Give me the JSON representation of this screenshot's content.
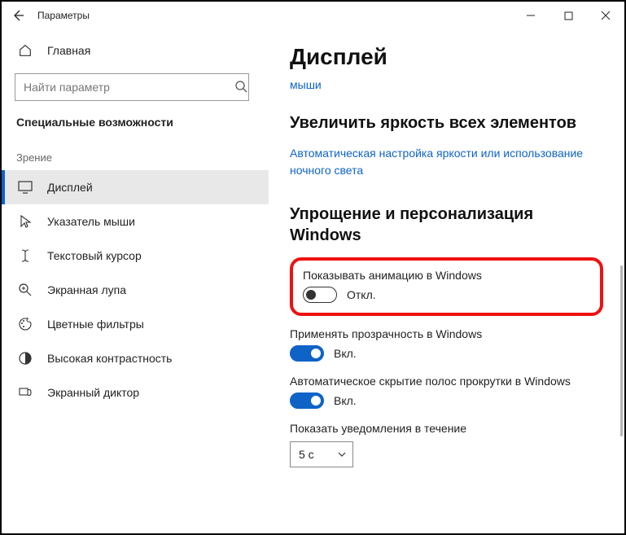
{
  "titlebar": {
    "title": "Параметры"
  },
  "sidebar": {
    "home": "Главная",
    "search_placeholder": "Найти параметр",
    "category": "Специальные возможности",
    "group_vision": "Зрение",
    "items": [
      {
        "label": "Дисплей"
      },
      {
        "label": "Указатель мыши"
      },
      {
        "label": "Текстовый курсор"
      },
      {
        "label": "Экранная лупа"
      },
      {
        "label": "Цветные фильтры"
      },
      {
        "label": "Высокая контрастность"
      },
      {
        "label": "Экранный диктор"
      }
    ]
  },
  "content": {
    "page_title": "Дисплей",
    "trunc_link": "мыши",
    "section_brightness": "Увеличить яркость всех элементов",
    "brightness_link": "Автоматическая настройка яркости или использование ночного света",
    "section_simplify": "Упрощение и персонализация Windows",
    "settings": {
      "anim": {
        "label": "Показывать анимацию в Windows",
        "state": "Откл."
      },
      "trans": {
        "label": "Применять прозрачность в Windows",
        "state": "Вкл."
      },
      "scroll": {
        "label": "Автоматическое скрытие полос прокрутки в Windows",
        "state": "Вкл."
      },
      "notif": {
        "label": "Показать уведомления в течение",
        "value": "5 с"
      }
    }
  }
}
